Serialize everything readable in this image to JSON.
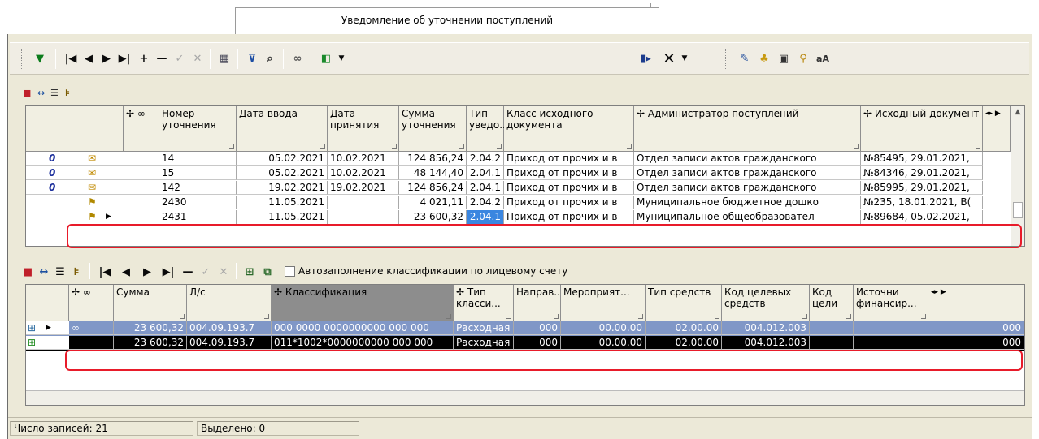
{
  "tab": {
    "title": "Уведомление об уточнении поступлений"
  },
  "toolbar2": {
    "autofill_label": "Автозаполнение классификации по лицевому счету"
  },
  "top_grid": {
    "columns": [
      "Номер уточнения",
      "Дата ввода",
      "Дата принятия",
      "Сумма уточнения",
      "Тип уведо...",
      "Класс исходного документа",
      "Администратор поступлений",
      "Исходный документ"
    ],
    "rows": [
      [
        "14",
        "05.02.2021",
        "10.02.2021",
        "124 856,24",
        "2.04.2",
        "Приход от прочих и в",
        "Отдел записи актов гражданского",
        "№85495, 29.01.2021,"
      ],
      [
        "15",
        "05.02.2021",
        "10.02.2021",
        "48 144,40",
        "2.04.1",
        "Приход от прочих и в",
        "Отдел записи актов гражданского",
        "№84346, 29.01.2021,"
      ],
      [
        "142",
        "19.02.2021",
        "19.02.2021",
        "124 856,24",
        "2.04.1",
        "Приход от прочих и в",
        "Отдел записи актов гражданского",
        "№85995, 29.01.2021,"
      ],
      [
        "2430",
        "11.05.2021",
        "",
        "4 021,11",
        "2.04.2",
        "Приход от прочих и в",
        "Муниципальное бюджетное дошко",
        "№235, 18.01.2021, B("
      ],
      [
        "2431",
        "11.05.2021",
        "",
        "23 600,32",
        "2.04.1",
        "Приход от прочих и в",
        "Муниципальное общеобразовател",
        "№89684, 05.02.2021,"
      ]
    ],
    "row_markers": [
      "0",
      "0",
      "0",
      "",
      ""
    ]
  },
  "bottom_grid": {
    "columns": [
      "Сумма",
      "Л/с",
      "Классификация",
      "Тип класси...",
      "Направ..",
      "Мероприят...",
      "Тип средств",
      "Код целевых средств",
      "Код цели",
      "Источни финансир..."
    ],
    "rows": [
      [
        "23 600,32",
        "004.09.193.7",
        "000 0000 0000000000 000 000",
        "Расходная",
        "000",
        "00.00.00",
        "02.00.00",
        "004.012.003",
        "",
        "000"
      ],
      [
        "23 600,32",
        "004.09.193.7",
        "011*1002*0000000000 000 000",
        "Расходная",
        "000",
        "00.00.00",
        "02.00.00",
        "004.012.003",
        "",
        "000"
      ]
    ]
  },
  "status": {
    "count_label": "Число записей: 21",
    "selected_label": "Выделено: 0"
  },
  "colors": {
    "highlight_red": "#e81b2a",
    "selection_blue": "#8097c7",
    "active_cell": "#3a86e0"
  }
}
